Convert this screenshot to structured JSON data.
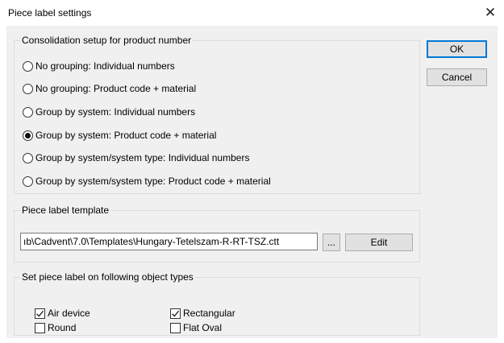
{
  "dialog": {
    "title": "Piece label settings",
    "close_glyph": "✕"
  },
  "consolidation": {
    "legend": "Consolidation setup for product number",
    "options": [
      {
        "label": "No grouping: Individual numbers",
        "checked": false
      },
      {
        "label": "No grouping: Product code + material",
        "checked": false
      },
      {
        "label": "Group by system: Individual numbers",
        "checked": false
      },
      {
        "label": "Group by system: Product code + material",
        "checked": true
      },
      {
        "label": "Group by system/system type: Individual numbers",
        "checked": false
      },
      {
        "label": "Group by system/system type: Product code + material",
        "checked": false
      }
    ]
  },
  "template": {
    "legend": "Piece label template",
    "path_value": "ıb\\Cadvent\\7.0\\Templates\\Hungary-Tetelszam-R-RT-TSZ.ctt",
    "browse_label": "...",
    "edit_label": "Edit"
  },
  "object_types": {
    "legend": "Set piece label on following object types",
    "items": [
      {
        "label": "Air device",
        "checked": true
      },
      {
        "label": "Rectangular",
        "checked": true
      },
      {
        "label": "Round",
        "checked": false
      },
      {
        "label": "Flat Oval",
        "checked": false
      }
    ]
  },
  "buttons": {
    "ok_label": "OK",
    "cancel_label": "Cancel"
  },
  "colors": {
    "dialog_background": "#f0f0f0",
    "default_button_border": "#0078d7",
    "button_face": "#e1e1e1"
  }
}
